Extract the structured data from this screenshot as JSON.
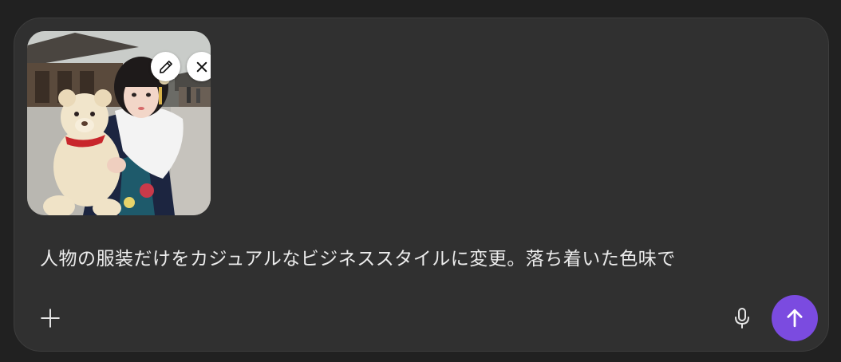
{
  "composer": {
    "prompt_text": "人物の服装だけをカジュアルなビジネススタイルに変更。落ち着いた色味で",
    "attachment": {
      "kind": "image-thumbnail",
      "edit_icon": "pencil-icon",
      "remove_icon": "close-icon"
    },
    "add_icon": "plus-icon",
    "mic_icon": "microphone-icon",
    "send_icon": "arrow-up-icon"
  },
  "colors": {
    "page_background": "#212121",
    "composer_background": "#303030",
    "send_button": "#7b4be0",
    "text": "#ececec"
  }
}
